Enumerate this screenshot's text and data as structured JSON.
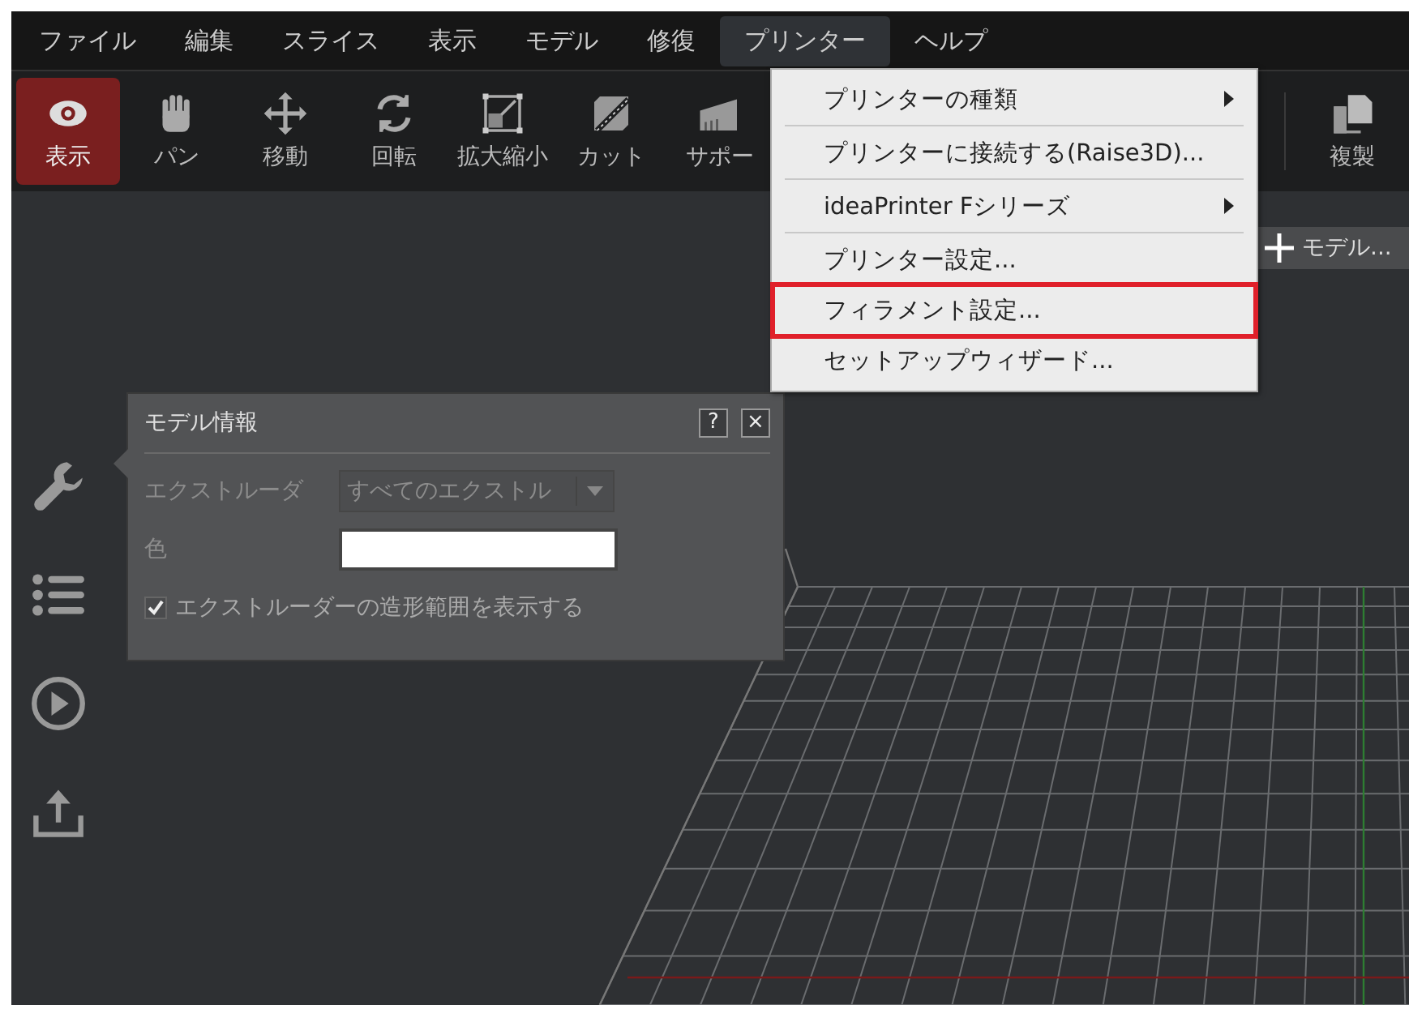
{
  "menu_bar": [
    {
      "label": "ファイル",
      "selected": false
    },
    {
      "label": "編集",
      "selected": false
    },
    {
      "label": "スライス",
      "selected": false
    },
    {
      "label": "表示",
      "selected": false
    },
    {
      "label": "モデル",
      "selected": false
    },
    {
      "label": "修復",
      "selected": false
    },
    {
      "label": "プリンター",
      "selected": true
    },
    {
      "label": "ヘルプ",
      "selected": false
    }
  ],
  "toolbar": [
    {
      "label": "表示",
      "selected": true
    },
    {
      "label": "パン",
      "selected": false
    },
    {
      "label": "移動",
      "selected": false
    },
    {
      "label": "回転",
      "selected": false
    },
    {
      "label": "拡大縮小",
      "selected": false
    },
    {
      "label": "カット",
      "selected": false
    },
    {
      "label": "サポー",
      "selected": false
    }
  ],
  "toolbar_right": {
    "label": "複製"
  },
  "add_model_button": {
    "label": "モデル..."
  },
  "printer_menu": [
    {
      "label": "プリンターの種類",
      "submenu": true,
      "separator_after": true,
      "highlighted": false
    },
    {
      "label": "プリンターに接続する(Raise3D)...",
      "submenu": false,
      "separator_after": true,
      "highlighted": false
    },
    {
      "label": "ideaPrinter Fシリーズ",
      "submenu": true,
      "separator_after": true,
      "highlighted": false
    },
    {
      "label": "プリンター設定...",
      "submenu": false,
      "separator_after": false,
      "highlighted": false
    },
    {
      "label": "フィラメント設定...",
      "submenu": false,
      "separator_after": false,
      "highlighted": true
    },
    {
      "label": "セットアップウィザード...",
      "submenu": false,
      "separator_after": false,
      "highlighted": false
    }
  ],
  "model_info_panel": {
    "title": "モデル情報",
    "help": "?",
    "close": "×",
    "extruder": {
      "label": "エクストルーダ",
      "value": "すべてのエクストル"
    },
    "color": {
      "label": "色"
    },
    "show_range": {
      "label": "エクストルーダーの造形範囲を表示する",
      "checked": true
    }
  }
}
